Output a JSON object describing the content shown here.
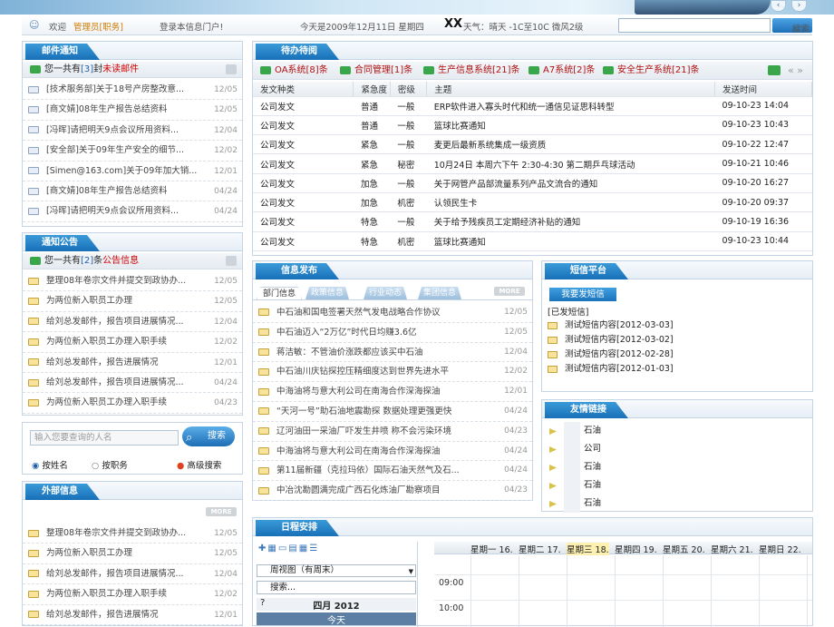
{
  "header": {
    "welcome": "欢迎",
    "role": "管理员[职务]",
    "login_text": "登录本信息门户!",
    "date": "今天是2009年12月11日 星期四",
    "city": "XX",
    "weather": "天气：晴天 -1C至10C 微风2级",
    "search_btn": "搜索"
  },
  "mail": {
    "title": "邮件通知",
    "summary_pre": "您一共有",
    "summary_count": "[3]",
    "summary_mid": "封",
    "summary_post": "未读邮件",
    "items": [
      {
        "text": "[技术服务部]关于18号产房整改意...",
        "date": "12/05"
      },
      {
        "text": "[商文婧]08年生产报告总结资料",
        "date": "12/05"
      },
      {
        "text": "[冯晖]请把明天9点会议所用资料...",
        "date": "12/04"
      },
      {
        "text": "[安全部]关于09年生产安全的细节...",
        "date": "12/02"
      },
      {
        "text": "[Simen@163.com]关于09年加大销...",
        "date": "12/01"
      },
      {
        "text": "[商文婧]08年生产报告总结资料",
        "date": "04/24"
      },
      {
        "text": "[冯晖]请把明天9点会议所用资料...",
        "date": "04/24"
      }
    ]
  },
  "notice": {
    "title": "通知公告",
    "summary_pre": "您一共有",
    "summary_count": "[2]",
    "summary_mid": "条",
    "summary_post": "公告信息",
    "items": [
      {
        "text": "整理08年卷宗文件并提交到政协办...",
        "date": "12/05"
      },
      {
        "text": "为两位新入职员工办理",
        "date": "12/05"
      },
      {
        "text": "给刘总发邮件，报告项目进展情况...",
        "date": "12/04"
      },
      {
        "text": "为两位新入职员工办理入职手续",
        "date": "12/02"
      },
      {
        "text": "给刘总发邮件，报告进展情况",
        "date": "12/01"
      },
      {
        "text": "给刘总发邮件，报告项目进展情况...",
        "date": "04/24"
      },
      {
        "text": "为两位新入职员工办理入职手续",
        "date": "04/23"
      }
    ]
  },
  "person_search": {
    "placeholder": "输入您要查询的人名",
    "button": "搜索",
    "opt1": "按姓名",
    "opt2": "按职务",
    "advanced": "高级搜索"
  },
  "external": {
    "title": "外部信息",
    "more": "MORE",
    "items": [
      {
        "text": "整理08年卷宗文件并提交到政协办...",
        "date": "12/05"
      },
      {
        "text": "为两位新入职员工办理",
        "date": "12/05"
      },
      {
        "text": "给刘总发邮件，报告项目进展情况...",
        "date": "12/04"
      },
      {
        "text": "为两位新入职员工办理入职手续",
        "date": "12/02"
      },
      {
        "text": "给刘总发邮件，报告进展情况",
        "date": "12/01"
      }
    ]
  },
  "todo": {
    "title": "待办待阅",
    "tabs": [
      "OA系统[8]条",
      "合同管理[1]条",
      "生产信息系统[21]条",
      "A7系统[2]条",
      "安全生产系统[21]条"
    ],
    "nav": "« »",
    "columns": [
      "发文种类",
      "紧急度",
      "密级",
      "主题",
      "发送时间"
    ],
    "rows": [
      [
        "公司发文",
        "普通",
        "一般",
        "ERP软件进入寡头时代和统一通信见证思科转型",
        "09-10-23 14:04"
      ],
      [
        "公司发文",
        "普通",
        "一般",
        "篮球比赛通知",
        "09-10-23 10:43"
      ],
      [
        "公司发文",
        "紧急",
        "一般",
        "麦更后最新系统集成一级资质",
        "09-10-22 12:47"
      ],
      [
        "公司发文",
        "紧急",
        "秘密",
        "10月24日 本周六下午 2:30-4:30 第二期乒乓球活动",
        "09-10-21 10:46"
      ],
      [
        "公司发文",
        "加急",
        "一般",
        "关于网管产品部流量系列产品文流合的通知",
        "09-10-20 16:27"
      ],
      [
        "公司发文",
        "加急",
        "机密",
        "认领民生卡",
        "09-10-20 09:37"
      ],
      [
        "公司发文",
        "特急",
        "一般",
        "关于给予残疾员工定期经济补贴的通知",
        "09-10-19 16:36"
      ],
      [
        "公司发文",
        "特急",
        "机密",
        "篮球比赛通知",
        "09-10-23 10:44"
      ]
    ]
  },
  "info": {
    "title": "信息发布",
    "tabs": [
      "部门信息",
      "政策信息",
      "行业动态",
      "集团信息"
    ],
    "more": "MORE",
    "items": [
      {
        "text": "中石油和国电签署天然气发电战略合作协议",
        "date": "12/05"
      },
      {
        "text": "中石油迈入“2万亿”时代日均赚3.6亿",
        "date": "12/05"
      },
      {
        "text": "蒋洁敏：不管油价涨跌都应该买中石油",
        "date": "12/04"
      },
      {
        "text": "中石油川庆钻探控压精细度达到世界先进水平",
        "date": "12/02"
      },
      {
        "text": "中海油将与意大利公司在南海合作深海探油",
        "date": "12/01"
      },
      {
        "text": "“天河一号”助石油地震勘探 数据处理更强更快",
        "date": "04/24"
      },
      {
        "text": "辽河油田一采油厂吓发生井喷 称不会污染环境",
        "date": "04/23"
      },
      {
        "text": "中海油将与意大利公司在南海合作深海探油",
        "date": "04/24"
      },
      {
        "text": "第11届新疆（克拉玛依）国际石油天然气及石...",
        "date": "04/24"
      },
      {
        "text": "中冶沈勘圆满完成广西石化炼油厂勘察项目",
        "date": "04/23"
      }
    ]
  },
  "sms": {
    "title": "短信平台",
    "send_btn": "我要发短信",
    "sent_label": "[已发短信]",
    "items": [
      "测试短信内容[2012-03-03]",
      "测试短信内容[2012-03-02]",
      "测试短信内容[2012-02-28]",
      "测试短信内容[2012-01-03]"
    ]
  },
  "links": {
    "title": "友情链接",
    "items": [
      "石油",
      "公司",
      "石油",
      "石油",
      "石油"
    ]
  },
  "schedule": {
    "title": "日程安排",
    "view": "周视图（有周末）",
    "search_placeholder": "搜索...",
    "month": "四月 2012",
    "today": "今天",
    "help": "?",
    "days": [
      "星期一 16.",
      "星期二 17.",
      "星期三 18.",
      "星期四 19.",
      "星期五 20.",
      "星期六 21.",
      "星期日 22."
    ],
    "times": [
      "09:00",
      "10:00"
    ]
  }
}
